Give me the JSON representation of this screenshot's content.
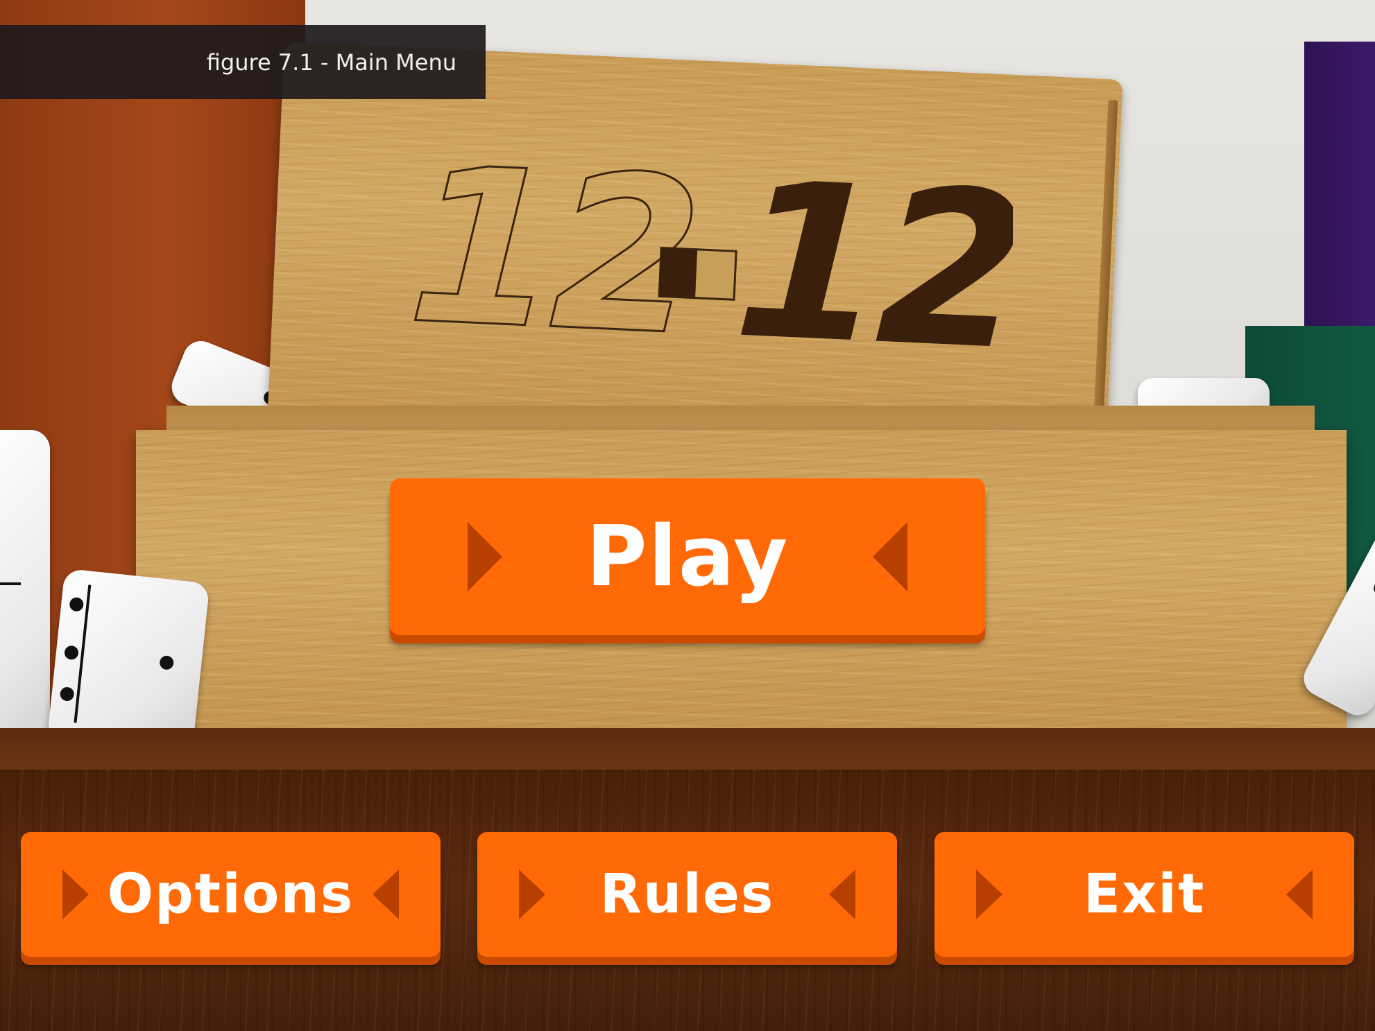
{
  "caption": {
    "text": "figure 7.1 - Main Menu"
  },
  "logo": {
    "left_number": "12",
    "right_number": "12"
  },
  "menu": {
    "play_label": "Play",
    "options_label": "Options",
    "rules_label": "Rules",
    "exit_label": "Exit"
  },
  "colors": {
    "button_orange": "#ff6a06",
    "button_shadow": "#c94b00",
    "arrow_dark": "#b73f00",
    "wood_light": "#d2a964",
    "shelf_dark": "#4a2009"
  },
  "icons": [
    "play-arrow-right-icon",
    "play-arrow-left-icon"
  ]
}
